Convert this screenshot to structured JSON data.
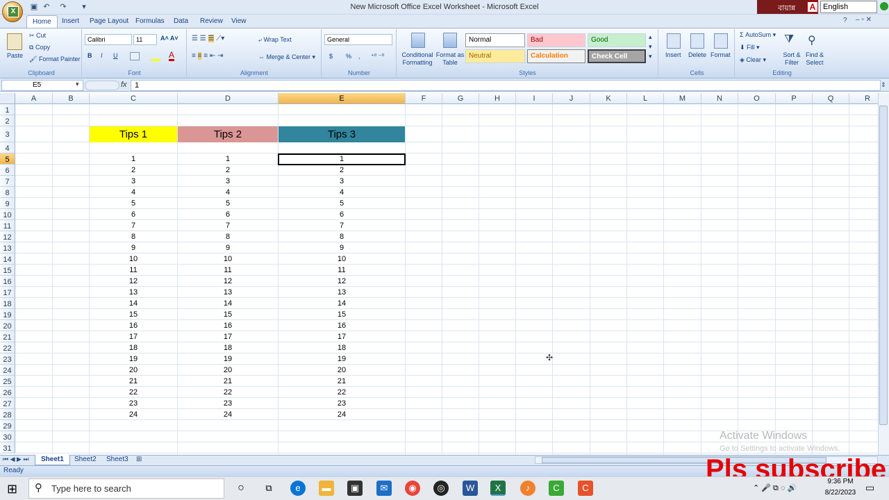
{
  "app": {
    "window_title": "New Microsoft Office Excel Worksheet - Microsoft Excel",
    "language": "English",
    "lang_tool": "বায়ান্ন"
  },
  "tabs": [
    "Home",
    "Insert",
    "Page Layout",
    "Formulas",
    "Data",
    "Review",
    "View"
  ],
  "ribbon": {
    "clipboard": {
      "paste": "Paste",
      "cut": "Cut",
      "copy": "Copy",
      "format_painter": "Format Painter",
      "label": "Clipboard"
    },
    "font": {
      "name": "Calibri",
      "size": "11",
      "label": "Font",
      "bold": "B",
      "italic": "I",
      "underline": "U"
    },
    "alignment": {
      "wrap": "Wrap Text",
      "merge": "Merge & Center",
      "label": "Alignment"
    },
    "number": {
      "format": "General",
      "currency": "$",
      "percent": "%",
      "comma": ",",
      "label": "Number"
    },
    "styles": {
      "conditional": "Conditional Formatting",
      "format_table": "Format as Table",
      "normal": "Normal",
      "bad": "Bad",
      "good": "Good",
      "neutral": "Neutral",
      "calculation": "Calculation",
      "check": "Check Cell",
      "label": "Styles"
    },
    "cells": {
      "insert": "Insert",
      "delete": "Delete",
      "format": "Format",
      "label": "Cells"
    },
    "editing": {
      "autosum": "AutoSum",
      "fill": "Fill",
      "clear": "Clear",
      "sort": "Sort & Filter",
      "find": "Find & Select",
      "label": "Editing"
    }
  },
  "formula_bar": {
    "name_box": "E5",
    "fx": "fx",
    "value": "1"
  },
  "grid": {
    "columns": [
      "A",
      "B",
      "C",
      "D",
      "E",
      "F",
      "G",
      "H",
      "I",
      "J",
      "K",
      "L",
      "M",
      "N",
      "O",
      "P",
      "Q",
      "R"
    ],
    "rows": [
      "1",
      "2",
      "3",
      "4",
      "5",
      "6",
      "7",
      "8",
      "9",
      "10",
      "11",
      "12",
      "13",
      "14",
      "15",
      "16",
      "17",
      "18",
      "19",
      "20",
      "21",
      "22",
      "23",
      "24",
      "25",
      "26",
      "27",
      "28",
      "29",
      "30",
      "31"
    ],
    "headers": {
      "c": "Tips 1",
      "d": "Tips 2",
      "e": "Tips 3"
    },
    "values": [
      "1",
      "2",
      "3",
      "4",
      "5",
      "6",
      "7",
      "8",
      "9",
      "10",
      "11",
      "12",
      "13",
      "14",
      "15",
      "16",
      "17",
      "18",
      "19",
      "20",
      "21",
      "22",
      "23",
      "24"
    ]
  },
  "sheets": [
    "Sheet1",
    "Sheet2",
    "Sheet3"
  ],
  "status": "Ready",
  "overlay": {
    "activate1": "Activate Windows",
    "activate2": "Go to Settings to activate Windows.",
    "subscribe": "Pls subscribe"
  },
  "taskbar": {
    "search_placeholder": "Type here to search",
    "time": "9:36 PM",
    "date": "8/22/2023"
  },
  "colors": {
    "tips1": "#ffff00",
    "tips2": "#da9694",
    "tips3": "#31859c",
    "selected_header": "#f2b44b"
  }
}
